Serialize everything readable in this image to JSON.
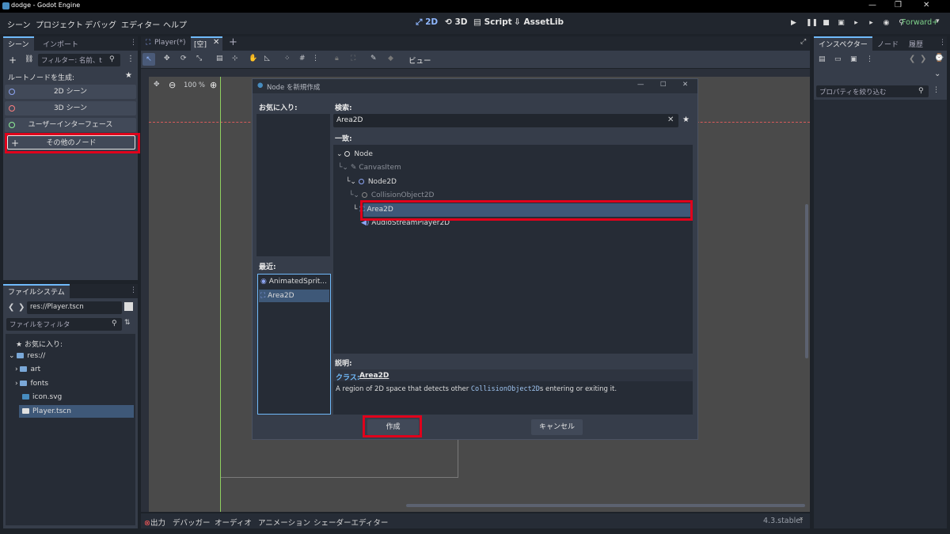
{
  "window": {
    "title": "dodge - Godot Engine",
    "controls": [
      "—",
      "❐",
      "✕"
    ]
  },
  "menubar": {
    "menus": [
      "シーン",
      "プロジェクト",
      "デバッグ",
      "エディター",
      "ヘルプ"
    ],
    "workspaces": [
      "2D",
      "3D",
      "Script",
      "AssetLib"
    ],
    "renderer": "Forward+"
  },
  "scene_dock": {
    "tabs": [
      "シーン",
      "インポート"
    ],
    "filter_placeholder": "フィルター: 名前、t",
    "root_label": "ルートノードを生成:",
    "buttons": [
      "2D シーン",
      "3D シーン",
      "ユーザーインターフェース",
      "その他のノード"
    ]
  },
  "filesystem_dock": {
    "tab": "ファイルシステム",
    "path": "res://Player.tscn",
    "filter_placeholder": "ファイルをフィルタ",
    "items": [
      "お気に入り:",
      "res://",
      "art",
      "fonts",
      "icon.svg",
      "Player.tscn"
    ]
  },
  "editor_tabs": {
    "tabs": [
      "Player(*)",
      "[空]"
    ],
    "view_label": "ビュー",
    "zoom": "100 %"
  },
  "dialog": {
    "title": "Node を新規作成",
    "favorites_label": "お気に入り:",
    "recent_label": "最近:",
    "recent_items": [
      "AnimatedSprit...",
      "Area2D"
    ],
    "search_label": "検索:",
    "search_value": "Area2D",
    "match_label": "一致:",
    "tree": [
      "Node",
      "CanvasItem",
      "Node2D",
      "CollisionObject2D",
      "Area2D",
      "AudioStreamPlayer2D"
    ],
    "desc_label": "説明:",
    "class_prefix": "クラス:",
    "class_name": "Area2D",
    "desc_text_1": "A region of 2D space that detects other ",
    "desc_code": "CollisionObject2D",
    "desc_text_2": "s entering or exiting it.",
    "create_button": "作成",
    "cancel_button": "キャンセル"
  },
  "bottom_panel": {
    "items": [
      "出力",
      "デバッガー",
      "オーディオ",
      "アニメーション",
      "シェーダーエディター"
    ],
    "version": "4.3.stable"
  },
  "inspector_dock": {
    "tabs": [
      "インスペクター",
      "ノード",
      "履歴"
    ],
    "filter_placeholder": "プロパティを絞り込む"
  },
  "colors": {
    "accent": "#70bafa",
    "highlight_red": "#e0001b",
    "selection": "#3e5878"
  }
}
